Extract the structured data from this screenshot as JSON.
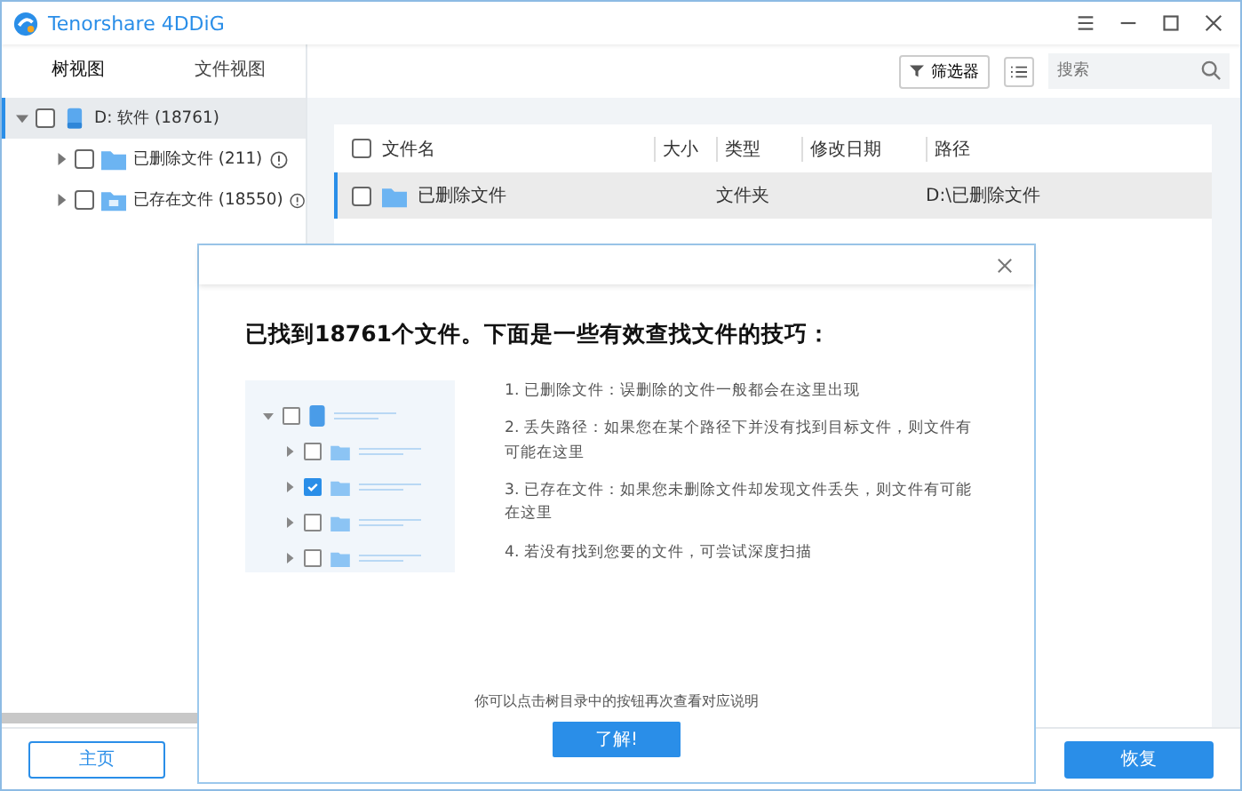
{
  "window": {
    "title": "Tenorshare 4DDiG"
  },
  "sidebar": {
    "tabs": [
      {
        "label": "树视图",
        "selected": true
      },
      {
        "label": "文件视图",
        "selected": false
      }
    ],
    "tree": [
      {
        "label": "D: 软件 (18761)",
        "kind": "drive",
        "expanded": true,
        "checked": false,
        "selected": true,
        "children": [
          {
            "label": "已删除文件 (211)",
            "kind": "folder",
            "expanded": false,
            "checked": false,
            "selected": false,
            "info": true
          },
          {
            "label": "已存在文件 (18550)",
            "kind": "existing",
            "expanded": false,
            "checked": false,
            "selected": false,
            "info": true
          }
        ]
      }
    ]
  },
  "toolbar": {
    "filter_label": "筛选器",
    "search": {
      "placeholder": "搜索"
    }
  },
  "table": {
    "all_checked": false,
    "columns": [
      "文件名",
      "大小",
      "类型",
      "修改日期",
      "路径"
    ],
    "rows": [
      {
        "name": "已删除文件",
        "kind": "folder",
        "size": "",
        "type": "文件夹",
        "date": "",
        "path": "D:\\已删除文件",
        "selected": true,
        "checked": false
      }
    ]
  },
  "dialog": {
    "heading": "已找到18761个文件。下面是一些有效查找文件的技巧：",
    "illustration": [
      {
        "checked": false
      },
      {
        "checked": true
      },
      {
        "checked": false
      },
      {
        "checked": false
      }
    ],
    "tips": [
      "1. 已删除文件：误删除的文件一般都会在这里出现",
      "2. 丢失路径：如果您在某个路径下并没有找到目标文件，则文件有可能在这里",
      "3. 已存在文件：如果您未删除文件却发现文件丢失，则文件有可能在这里",
      "4. 若没有找到您要的文件，可尝试深度扫描"
    ],
    "note": "你可以点击树目录中的按钮再次查看对应说明",
    "ok": "了解!"
  },
  "footer": {
    "home": "主页",
    "recover": "恢复"
  }
}
